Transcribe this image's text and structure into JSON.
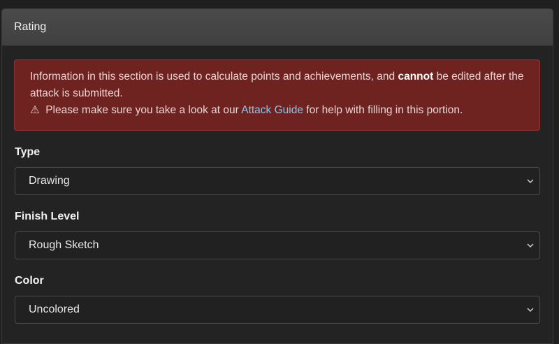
{
  "panel": {
    "title": "Rating"
  },
  "alert": {
    "text_part1": "Information in this section is used to calculate points and achievements, and ",
    "bold_word": "cannot",
    "text_part2": " be edited after the attack is submitted.",
    "warning_glyph": "⚠",
    "line2_before": " Please make sure you take a look at our ",
    "link_text": "Attack Guide",
    "line2_after": " for help with filling in this portion."
  },
  "fields": {
    "type": {
      "label": "Type",
      "value": "Drawing"
    },
    "finish_level": {
      "label": "Finish Level",
      "value": "Rough Sketch"
    },
    "color": {
      "label": "Color",
      "value": "Uncolored"
    }
  },
  "colors": {
    "alert_bg": "#6e2320",
    "link": "#8fc3ea"
  }
}
